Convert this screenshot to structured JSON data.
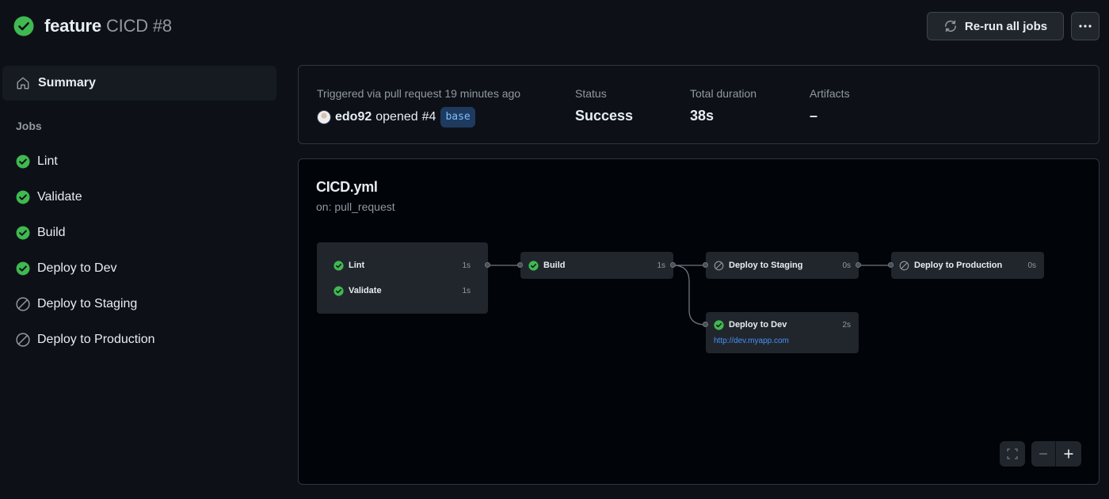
{
  "header": {
    "branch": "feature",
    "run_title": "CICD #8",
    "status_icon": "check-circle-fill-icon",
    "rerun_label": "Re-run all jobs",
    "more_label": "···"
  },
  "sidebar": {
    "summary_label": "Summary",
    "jobs_heading": "Jobs",
    "jobs": [
      {
        "name": "Lint",
        "status": "success"
      },
      {
        "name": "Validate",
        "status": "success"
      },
      {
        "name": "Build",
        "status": "success"
      },
      {
        "name": "Deploy to Dev",
        "status": "success"
      },
      {
        "name": "Deploy to Staging",
        "status": "skipped"
      },
      {
        "name": "Deploy to Production",
        "status": "skipped"
      }
    ]
  },
  "summary": {
    "trigger_label": "Triggered via pull request 19 minutes ago",
    "actor": "edo92",
    "opened_text": "opened",
    "pr_number": "#4",
    "branch_tag": "base",
    "status_label": "Status",
    "status_value": "Success",
    "duration_label": "Total duration",
    "duration_value": "38s",
    "artifacts_label": "Artifacts",
    "artifacts_value": "–"
  },
  "workflow": {
    "file": "CICD.yml",
    "trigger": "on: pull_request",
    "nodes": {
      "lint": {
        "name": "Lint",
        "duration": "1s",
        "status": "success"
      },
      "validate": {
        "name": "Validate",
        "duration": "1s",
        "status": "success"
      },
      "build": {
        "name": "Build",
        "duration": "1s",
        "status": "success"
      },
      "staging": {
        "name": "Deploy to Staging",
        "duration": "0s",
        "status": "skipped"
      },
      "production": {
        "name": "Deploy to Production",
        "duration": "0s",
        "status": "skipped"
      },
      "dev": {
        "name": "Deploy to Dev",
        "duration": "2s",
        "status": "success",
        "link": "http://dev.myapp.com"
      }
    }
  },
  "colors": {
    "success": "#3fb950",
    "skipped": "#9198a1",
    "link": "#4493f8",
    "background": "#0d1117"
  }
}
